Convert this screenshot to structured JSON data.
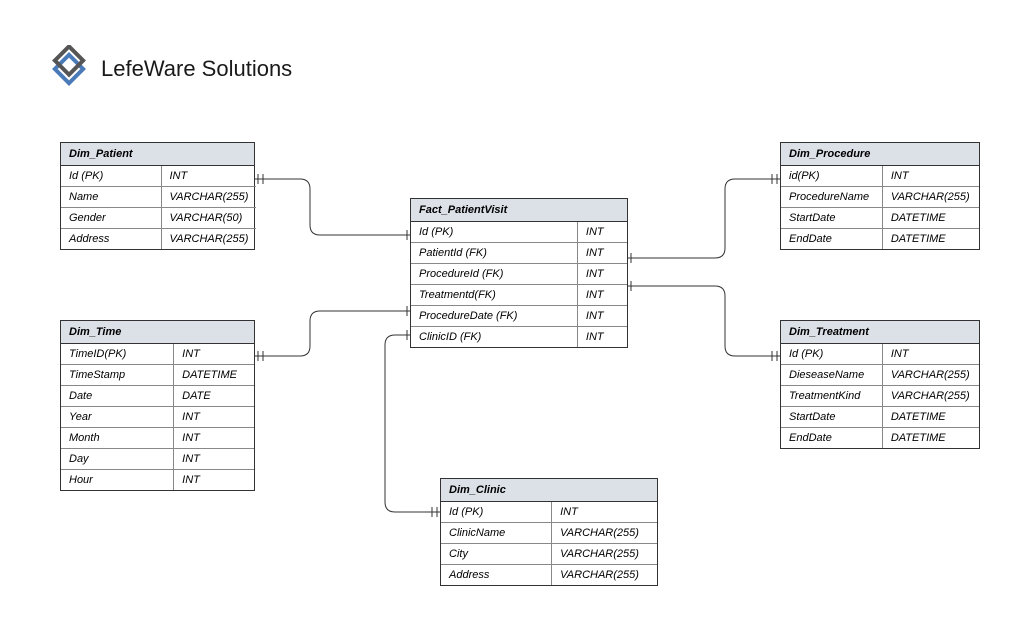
{
  "logo": {
    "text": "LefeWare Solutions"
  },
  "tables": {
    "dim_patient": {
      "title": "Dim_Patient",
      "rows": [
        {
          "name": "Id (PK)",
          "type": "INT"
        },
        {
          "name": "Name",
          "type": "VARCHAR(255)"
        },
        {
          "name": "Gender",
          "type": "VARCHAR(50)"
        },
        {
          "name": "Address",
          "type": "VARCHAR(255)"
        }
      ]
    },
    "dim_time": {
      "title": "Dim_Time",
      "rows": [
        {
          "name": "TimeID(PK)",
          "type": "INT"
        },
        {
          "name": "TimeStamp",
          "type": "DATETIME"
        },
        {
          "name": "Date",
          "type": "DATE"
        },
        {
          "name": "Year",
          "type": "INT"
        },
        {
          "name": "Month",
          "type": "INT"
        },
        {
          "name": "Day",
          "type": "INT"
        },
        {
          "name": "Hour",
          "type": "INT"
        }
      ]
    },
    "fact_patient_visit": {
      "title": "Fact_PatientVisit",
      "rows": [
        {
          "name": "Id (PK)",
          "type": "INT"
        },
        {
          "name": "PatientId (FK)",
          "type": "INT"
        },
        {
          "name": "ProcedureId (FK)",
          "type": "INT"
        },
        {
          "name": "Treatmentd(FK)",
          "type": "INT"
        },
        {
          "name": "ProcedureDate (FK)",
          "type": "INT"
        },
        {
          "name": "ClinicID (FK)",
          "type": "INT"
        }
      ]
    },
    "dim_procedure": {
      "title": "Dim_Procedure",
      "rows": [
        {
          "name": "id(PK)",
          "type": "INT"
        },
        {
          "name": "ProcedureName",
          "type": "VARCHAR(255)"
        },
        {
          "name": "StartDate",
          "type": "DATETIME"
        },
        {
          "name": "EndDate",
          "type": "DATETIME"
        }
      ]
    },
    "dim_treatment": {
      "title": "Dim_Treatment",
      "rows": [
        {
          "name": "Id (PK)",
          "type": "INT"
        },
        {
          "name": "DieseaseName",
          "type": "VARCHAR(255)"
        },
        {
          "name": "TreatmentKind",
          "type": "VARCHAR(255)"
        },
        {
          "name": "StartDate",
          "type": "DATETIME"
        },
        {
          "name": "EndDate",
          "type": "DATETIME"
        }
      ]
    },
    "dim_clinic": {
      "title": "Dim_Clinic",
      "rows": [
        {
          "name": "Id (PK)",
          "type": "INT"
        },
        {
          "name": "ClinicName",
          "type": "VARCHAR(255)"
        },
        {
          "name": "City",
          "type": "VARCHAR(255)"
        },
        {
          "name": "Address",
          "type": "VARCHAR(255)"
        }
      ]
    }
  }
}
